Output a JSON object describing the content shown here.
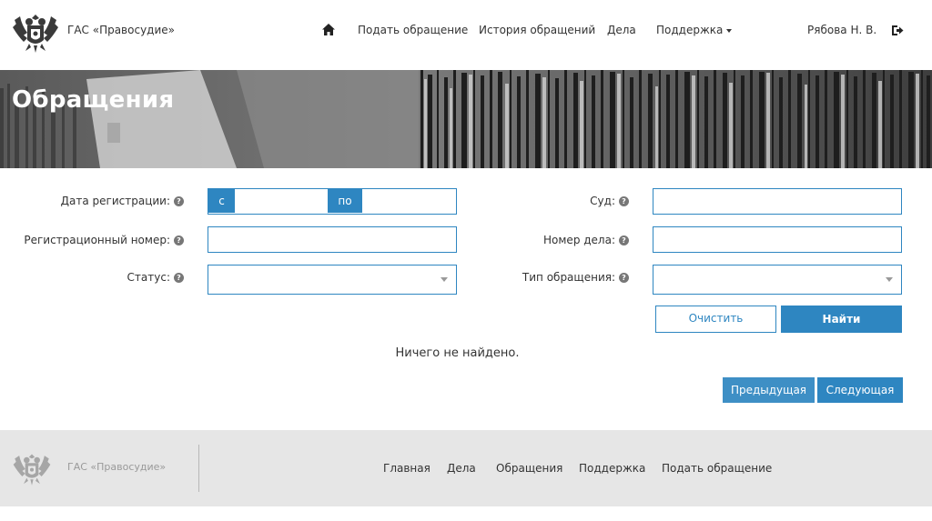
{
  "header": {
    "brand": "ГАС «Правосудие»",
    "nav": {
      "submit": "Подать обращение",
      "history": "История обращений",
      "cases": "Дела",
      "support": "Поддержка"
    },
    "user": "Рябова Н. В."
  },
  "banner": {
    "title": "Обращения"
  },
  "form": {
    "date_label": "Дата регистрации:",
    "date_from": "с",
    "date_to": "по",
    "reg_number_label": "Регистрационный номер:",
    "status_label": "Статус:",
    "court_label": "Суд:",
    "case_number_label": "Номер дела:",
    "type_label": "Тип обращения:",
    "clear_button": "Очистить",
    "find_button": "Найти"
  },
  "results": {
    "empty_message": "Ничего не найдено.",
    "prev_button": "Предыдущая",
    "next_button": "Следующая"
  },
  "footer": {
    "brand": "ГАС «Правосудие»",
    "nav": {
      "home": "Главная",
      "cases": "Дела",
      "requests": "Обращения",
      "support": "Поддержка",
      "submit": "Подать обращение"
    }
  },
  "colors": {
    "accent": "#2e86c1",
    "footer_bg": "#e6e6e6"
  }
}
